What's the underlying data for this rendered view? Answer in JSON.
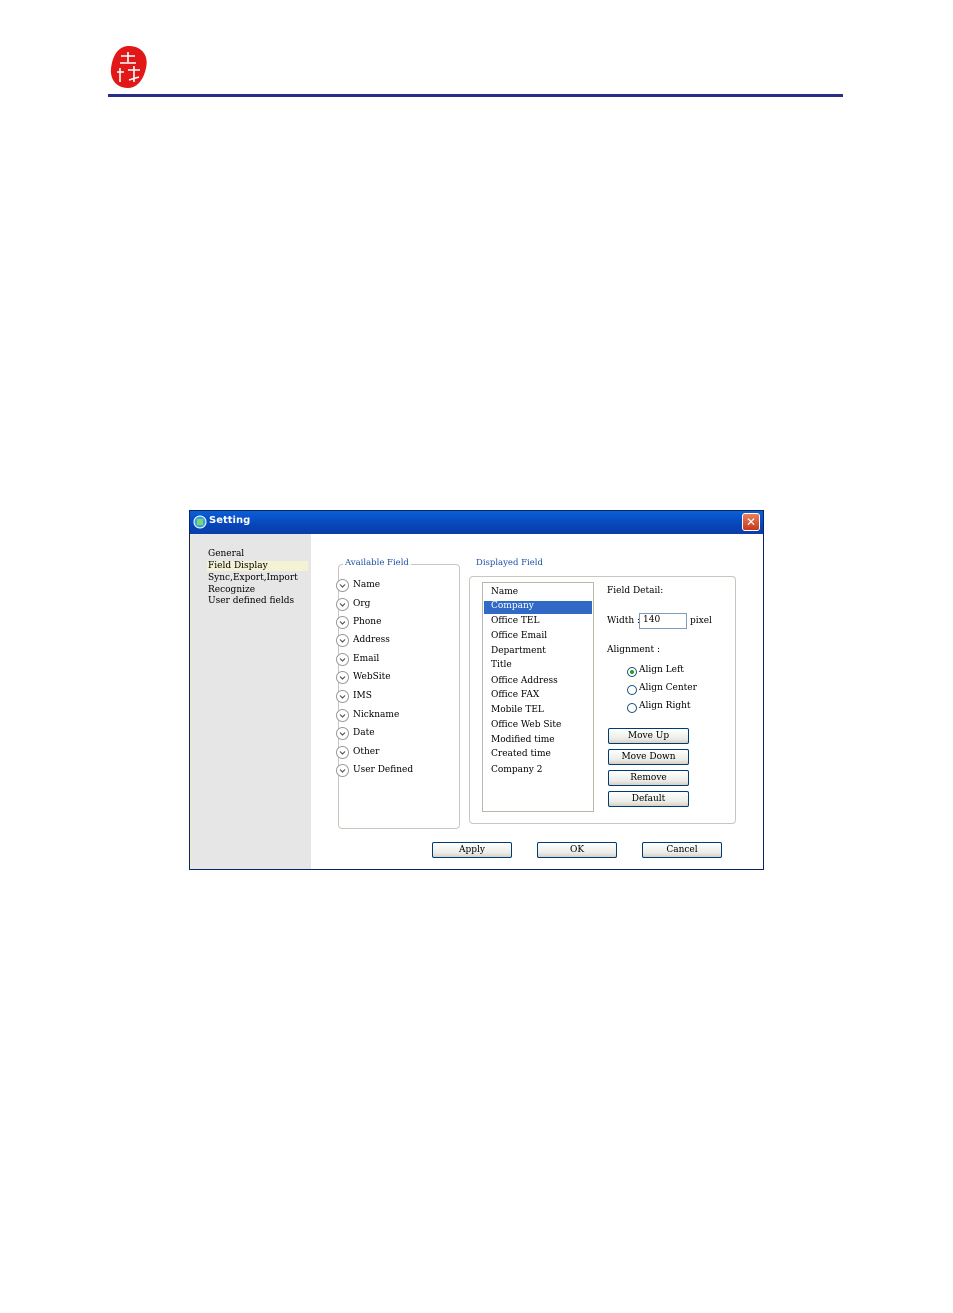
{
  "header": {
    "logo_text": "",
    "rule_color": "#2a2f86"
  },
  "window": {
    "title": "Setting",
    "close_glyph": "✕",
    "nav": [
      "General",
      "Field Display",
      "Sync,Export,Import",
      "Recognize",
      "User defined fields"
    ],
    "selected_nav": "Field Display",
    "available": {
      "label": "Available Field",
      "items": [
        "Name",
        "Org",
        "Phone",
        "Address",
        "Email",
        "WebSite",
        "IMS",
        "Nickname",
        "Date",
        "Other",
        "User Defined"
      ]
    },
    "displayed": {
      "label": "Displayed Field",
      "items": [
        "Name",
        "Company",
        "Office TEL",
        "Office Email",
        "Department",
        "Title",
        "Office Address",
        "Office FAX",
        "Mobile TEL",
        "Office Web Site",
        "Modified time",
        "Created time",
        "Company 2"
      ],
      "selected": "Company"
    },
    "detail": {
      "label": "Field Detail:",
      "width_label": "Width :",
      "width_value": "140",
      "width_unit": "pixel",
      "alignment_label": "Alignment :",
      "align_left": "Align Left",
      "align_center": "Align Center",
      "align_right": "Align Right",
      "selected_alignment": "Align Left",
      "move_up": "Move Up",
      "move_down": "Move Down",
      "remove": "Remove",
      "default": "Default"
    },
    "buttons": {
      "apply": "Apply",
      "ok": "OK",
      "cancel": "Cancel"
    }
  },
  "colors": {
    "titlebar": "#0a5fd8",
    "selection": "#3169c6",
    "group_label": "#1a4fa6"
  }
}
